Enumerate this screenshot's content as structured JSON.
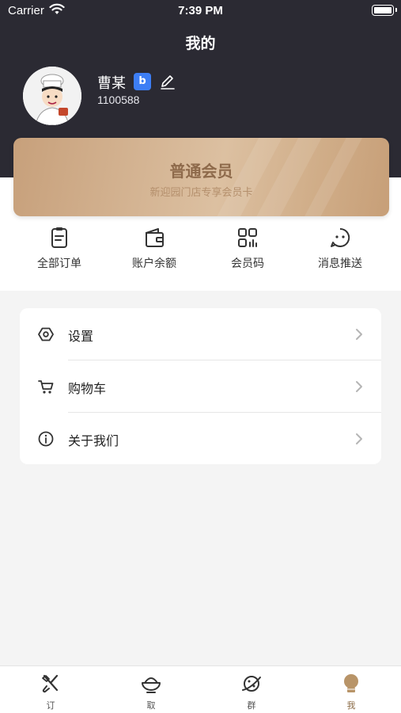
{
  "status_bar": {
    "carrier": "Carrier",
    "time": "7:39 PM"
  },
  "header": {
    "title": "我的"
  },
  "profile": {
    "name": "曹某",
    "id": "1100588"
  },
  "member_card": {
    "title": "普通会员",
    "subtitle": "新迎园门店专享会员卡"
  },
  "quick_actions": [
    {
      "label": "全部订单",
      "icon": "order-list-icon"
    },
    {
      "label": "账户余额",
      "icon": "wallet-icon"
    },
    {
      "label": "会员码",
      "icon": "qr-code-icon"
    },
    {
      "label": "消息推送",
      "icon": "message-icon"
    }
  ],
  "menu": [
    {
      "label": "设置",
      "icon": "settings-icon"
    },
    {
      "label": "购物车",
      "icon": "cart-icon"
    },
    {
      "label": "关于我们",
      "icon": "info-icon"
    }
  ],
  "tabs": [
    {
      "label": "订",
      "icon": "utensils-icon",
      "active": false
    },
    {
      "label": "取",
      "icon": "bowl-icon",
      "active": false
    },
    {
      "label": "群",
      "icon": "planet-icon",
      "active": false
    },
    {
      "label": "我",
      "icon": "user-icon",
      "active": true
    }
  ],
  "colors": {
    "header_bg": "#2b2a33",
    "card_gold": "#d6b893",
    "accent_brown": "#8a6a45",
    "badge_blue": "#3d7ef5"
  }
}
